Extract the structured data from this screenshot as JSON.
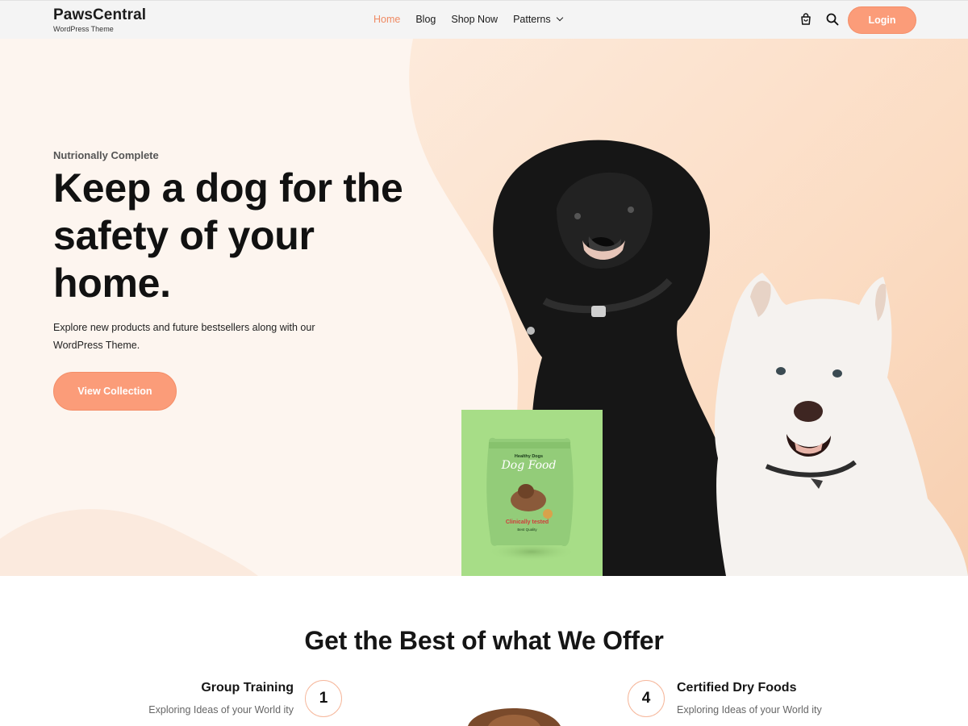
{
  "header": {
    "brand_name": "PawsCentral",
    "brand_tagline": "WordPress Theme",
    "nav": [
      "Home",
      "Blog",
      "Shop Now",
      "Patterns"
    ],
    "active_nav": "Home",
    "login_label": "Login",
    "icons": [
      "shopping-bag-icon",
      "search-icon",
      "chevron-down-icon"
    ]
  },
  "hero": {
    "eyebrow": "Nutrionally Complete",
    "title": "Keep a dog for the safety of your home.",
    "description": "Explore new products and future bestsellers along with our WordPress Theme.",
    "cta_label": "View Collection",
    "product": {
      "brand": "Healthy Dogs",
      "name": "Dog Food",
      "tag": "Clinically tested",
      "quality": "Best Quality"
    }
  },
  "offer": {
    "title": "Get the Best of what We Offer",
    "features": [
      {
        "number": "1",
        "title": "Group Training",
        "description": "Exploring Ideas of your World ity"
      },
      {
        "number": "4",
        "title": "Certified Dry Foods",
        "description": "Exploring Ideas of your World ity"
      }
    ]
  },
  "colors": {
    "accent": "#fb9c79",
    "active_nav": "#ef8a63",
    "hero_bg": "#fdf5ef",
    "product_bg": "#a7dd87"
  }
}
